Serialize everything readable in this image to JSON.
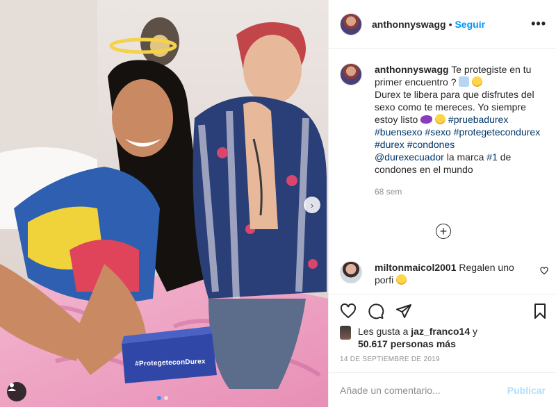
{
  "post": {
    "username": "anthonnyswagg",
    "follow_label": "Seguir",
    "header_dot": "•",
    "more_label": "•••",
    "box_text": "#ProtegeteconDurex"
  },
  "caption": {
    "username": "anthonnyswagg",
    "text_1": "Te protegiste en tu primer encuentro ?",
    "text_2": "Durex te libera para que disfrutes del sexo como te mereces. Yo siempre estoy listo",
    "tags": [
      "#pruebadurex",
      "#buensexo",
      "#sexo",
      "#protegetecondurex",
      "#durex",
      "#condones"
    ],
    "mention": "@durexecuador",
    "text_3": "la marca",
    "tag_num": "#1",
    "text_4": "de condones en el mundo",
    "time_ago": "68 sem"
  },
  "load_more_label": "+",
  "comment": {
    "username": "miltonmaicol2001",
    "text": "Regalen uno porfi"
  },
  "actions": {
    "icons": [
      "heart-icon",
      "comment-icon",
      "share-icon",
      "bookmark-icon"
    ]
  },
  "likes": {
    "prefix": "Les gusta a",
    "user": "jaz_franco14",
    "joiner": "y",
    "count": "50.617 personas más"
  },
  "date": "14 DE SEPTIEMBRE DE 2019",
  "add_comment": {
    "placeholder": "Añade un comentario...",
    "publish_label": "Publicar"
  },
  "colors": {
    "accent": "#0095f6",
    "publish_disabled": "#b2dffc",
    "hashtag": "#00376b",
    "meta": "#8e8e8e"
  }
}
